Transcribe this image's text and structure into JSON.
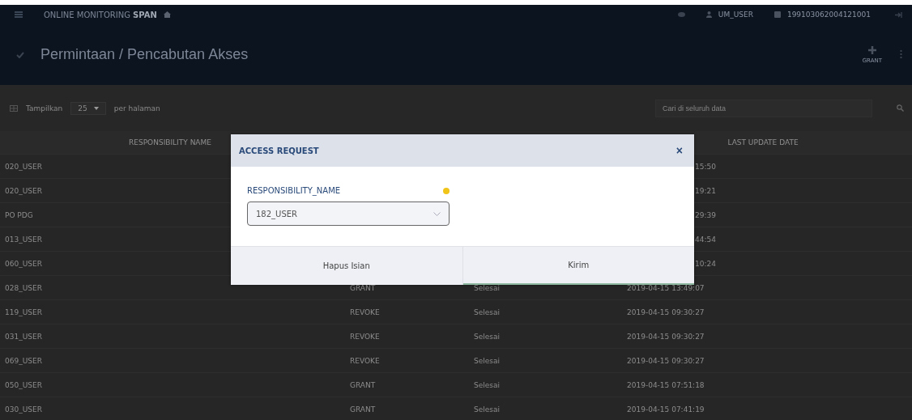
{
  "navbar": {
    "app_name": "ONLINE MONITORING",
    "app_name_bold": "SPAN",
    "user": "UM_USER",
    "nip": "199103062004121001"
  },
  "page": {
    "title": "Permintaan / Pencabutan Akses",
    "action": "GRANT"
  },
  "toolbar": {
    "show_label": "Tampilkan",
    "page_size": "25",
    "per_page_label": "per halaman",
    "search_placeholder": "Cari di seluruh data"
  },
  "table": {
    "columns": [
      {
        "label": "RESPONSIBILITY NAME"
      },
      {},
      {},
      {
        "label": "LAST UPDATE DATE"
      }
    ],
    "rows": [
      {
        "name": "020_USER",
        "date": "15:50"
      },
      {
        "name": "020_USER",
        "date": "19:21"
      },
      {
        "name": "PO PDG",
        "date": "29:39"
      },
      {
        "name": "013_USER",
        "date": "44:54"
      },
      {
        "name": "060_USER",
        "date": "10:24"
      },
      {
        "name": "028_USER",
        "type": "GRANT",
        "status": "Selesai",
        "date": "2019-04-15 13:49:07"
      },
      {
        "name": "119_USER",
        "type": "REVOKE",
        "status": "Selesai",
        "date": "2019-04-15 09:30:27"
      },
      {
        "name": "031_USER",
        "type": "REVOKE",
        "status": "Selesai",
        "date": "2019-04-15 09:30:27"
      },
      {
        "name": "069_USER",
        "type": "REVOKE",
        "status": "Selesai",
        "date": "2019-04-15 09:30:27"
      },
      {
        "name": "050_USER",
        "type": "GRANT",
        "status": "Selesai",
        "date": "2019-04-15 07:51:18"
      },
      {
        "name": "030_USER",
        "type": "GRANT",
        "status": "Selesai",
        "date": "2019-04-15 07:41:19"
      }
    ]
  },
  "modal": {
    "title": "ACCESS REQUEST",
    "close": "×",
    "field_label": "RESPONSIBILITY_NAME",
    "field_value": "182_USER",
    "buttons": [
      "Hapus Isian",
      "Kirim"
    ]
  }
}
